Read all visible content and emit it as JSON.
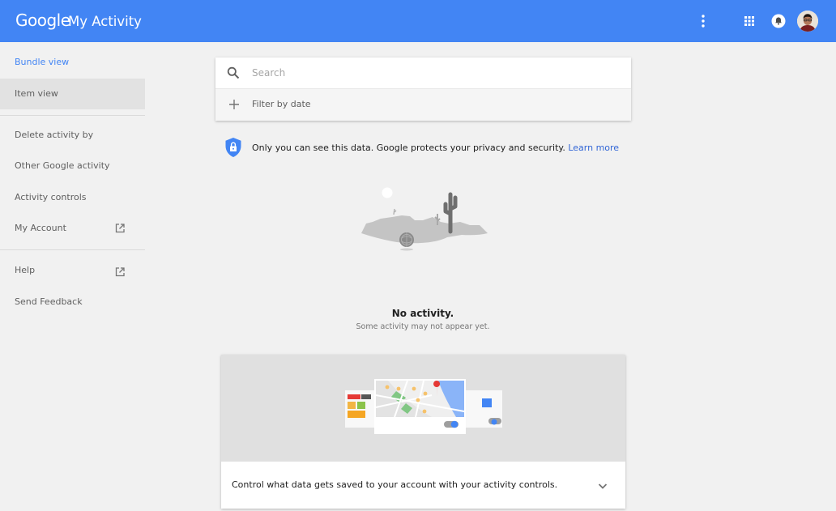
{
  "header": {
    "brand": "Google",
    "product": "My Activity",
    "icons": [
      "more-vert-icon",
      "apps-grid-icon",
      "notifications-bell-icon",
      "account-avatar"
    ],
    "color": "#4285f4"
  },
  "sidebar": {
    "items": [
      {
        "label": "Bundle view",
        "state": "active"
      },
      {
        "label": "Item view",
        "state": "selected"
      },
      {
        "label": "Delete activity by"
      },
      {
        "label": "Other Google activity"
      },
      {
        "label": "Activity controls"
      },
      {
        "label": "My Account",
        "icon": "open-in-new-icon"
      },
      {
        "label": "Help",
        "icon": "open-in-new-icon"
      },
      {
        "label": "Send Feedback"
      }
    ]
  },
  "search": {
    "placeholder": "Search",
    "value": "",
    "filter_label": "Filter by date"
  },
  "privacy": {
    "text": "Only you can see this data. Google protects your privacy and security.",
    "link": "Learn more"
  },
  "empty_state": {
    "title": "No activity.",
    "subtitle": "Some activity may not appear yet."
  },
  "controls_card": {
    "text": "Control what data gets saved to your account with your activity controls."
  },
  "colors": {
    "accent": "#4285f4",
    "link": "#3367d6",
    "background": "#f1f1f1"
  }
}
